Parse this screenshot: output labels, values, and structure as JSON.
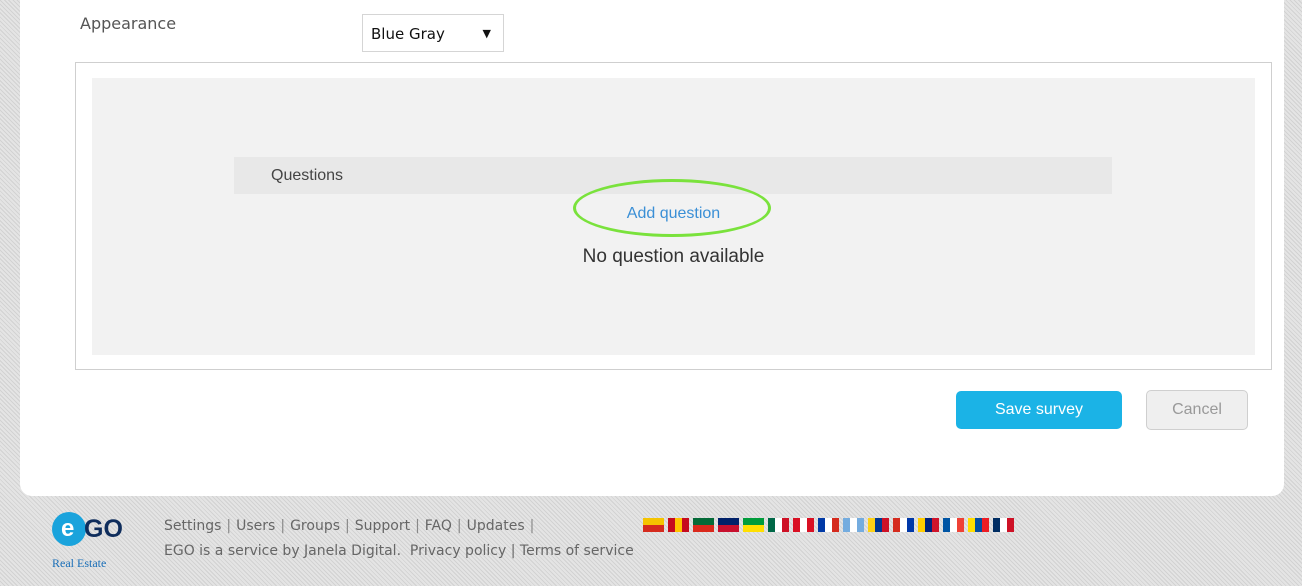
{
  "appearance": {
    "label": "Appearance",
    "selected": "Blue Gray"
  },
  "survey": {
    "questions_title": "Questions",
    "add_question": "Add question",
    "empty_message": "No question available"
  },
  "actions": {
    "save": "Save survey",
    "cancel": "Cancel"
  },
  "footer": {
    "links": [
      "Settings",
      "Users",
      "Groups",
      "Support",
      "FAQ",
      "Updates"
    ],
    "credit_text": "EGO is a service by Janela Digital.",
    "privacy": "Privacy policy",
    "terms": "Terms of service",
    "logo_text": "GO",
    "logo_mark": "e",
    "logo_sub": "Real Estate",
    "flags": [
      {
        "name": "catalonia-flag-icon",
        "colors": [
          "#f5c400",
          "#d52b1e"
        ]
      },
      {
        "name": "spain-flag-icon",
        "colors": [
          "#c60b1e",
          "#ffc400",
          "#c60b1e"
        ]
      },
      {
        "name": "portugal-flag-icon",
        "colors": [
          "#046a38",
          "#da291c"
        ]
      },
      {
        "name": "uk-flag-icon",
        "colors": [
          "#012169",
          "#c8102e"
        ]
      },
      {
        "name": "brazil-flag-icon",
        "colors": [
          "#009c3b",
          "#ffdf00"
        ]
      },
      {
        "name": "mexico-flag-icon",
        "colors": [
          "#006847",
          "#ffffff",
          "#ce1126"
        ]
      },
      {
        "name": "peru-flag-icon",
        "colors": [
          "#d91023",
          "#ffffff",
          "#d91023"
        ]
      },
      {
        "name": "chile-flag-icon",
        "colors": [
          "#0039a6",
          "#ffffff",
          "#d52b1e"
        ]
      },
      {
        "name": "argentina-flag-icon",
        "colors": [
          "#74acdf",
          "#ffffff",
          "#74acdf"
        ]
      },
      {
        "name": "colombia-flag-icon",
        "colors": [
          "#fcd116",
          "#003893",
          "#ce1126"
        ]
      },
      {
        "name": "paraguay-flag-icon",
        "colors": [
          "#d52b1e",
          "#ffffff",
          "#0038a8"
        ]
      },
      {
        "name": "venezuela-flag-icon",
        "colors": [
          "#ffcc00",
          "#00247d",
          "#cf142b"
        ]
      },
      {
        "name": "france-flag-icon",
        "colors": [
          "#0055a4",
          "#ffffff",
          "#ef4135"
        ]
      },
      {
        "name": "ecuador-flag-icon",
        "colors": [
          "#ffdd00",
          "#034ea2",
          "#ed1c24"
        ]
      },
      {
        "name": "dominican-republic-flag-icon",
        "colors": [
          "#002d62",
          "#ffffff",
          "#ce1126"
        ]
      }
    ]
  },
  "colors": {
    "accent": "#1bb3e6",
    "highlight_ring": "#7ae23c",
    "link": "#3a8fd6"
  }
}
